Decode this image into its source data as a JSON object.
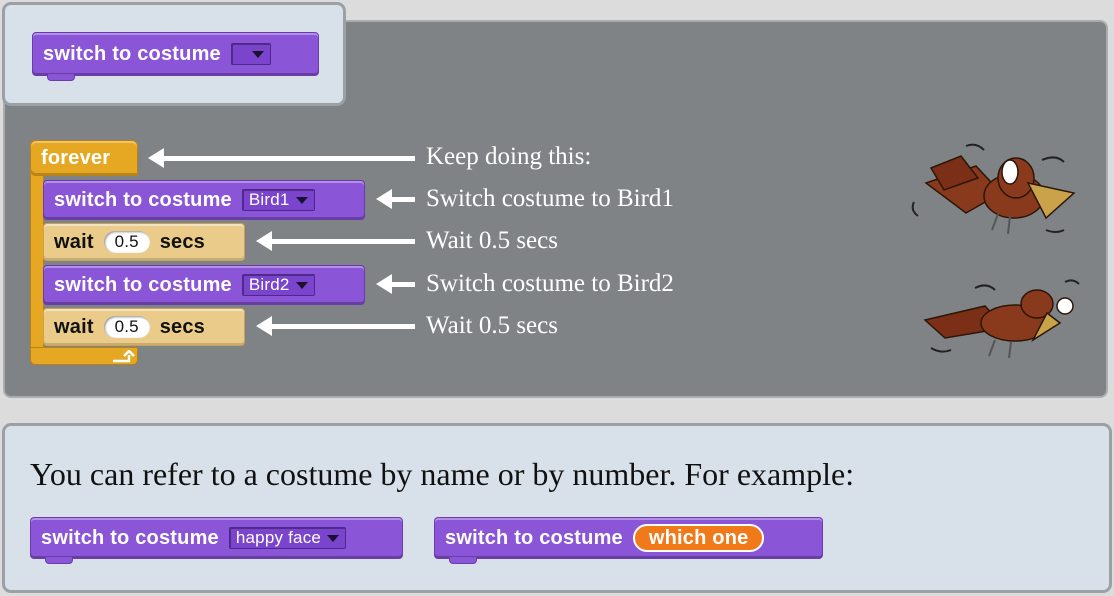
{
  "example_block": {
    "text": "switch to costume"
  },
  "script": {
    "forever_label": "forever",
    "step1": {
      "label": "switch to costume",
      "value": "Bird1"
    },
    "step2": {
      "label": "wait",
      "value": "0.5",
      "unit": "secs"
    },
    "step3": {
      "label": "switch to costume",
      "value": "Bird2"
    },
    "step4": {
      "label": "wait",
      "value": "0.5",
      "unit": "secs"
    }
  },
  "annotations": {
    "forever": "Keep doing this:",
    "step1": "Switch costume to Bird1",
    "step2": "Wait 0.5 secs",
    "step3": "Switch costume to Bird2",
    "step4": "Wait 0.5 secs"
  },
  "bottom": {
    "description": "You can refer to a costume by name or by number. For example:",
    "example1": {
      "label": "switch to costume",
      "value": "happy face"
    },
    "example2": {
      "label": "switch to costume",
      "reporter": "which one"
    }
  },
  "colors": {
    "looks": "#8a55d7",
    "control": "#e6a822",
    "wait": "#eacb8a",
    "reporter": "#f07a1a",
    "panel_dark": "#7f8385",
    "panel_light": "#d8e1ea"
  }
}
